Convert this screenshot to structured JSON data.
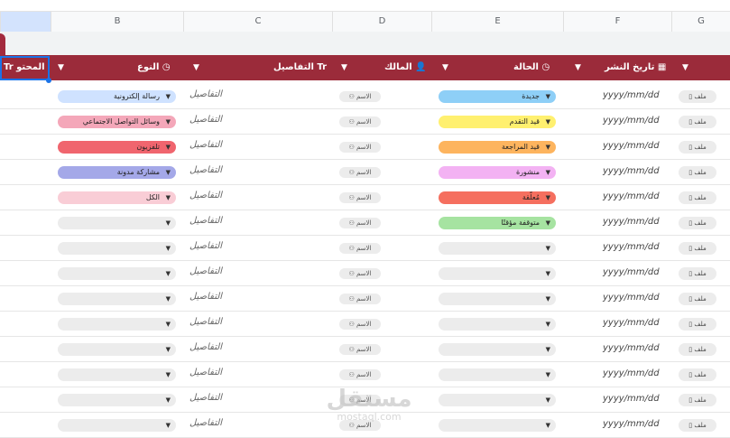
{
  "columns": [
    "B",
    "C",
    "D",
    "E",
    "F",
    "G"
  ],
  "headers": {
    "content": "المحتو",
    "type": "النوع",
    "details": "التفاصيل",
    "owner": "المالك",
    "status": "الحالة",
    "publish_date": "تاريخ النشر"
  },
  "header_icon_text": "Tr",
  "colors": {
    "header_bg": "#9b2b3a",
    "type_chips": [
      "#cfe2ff",
      "#f4a7b9",
      "#f0656e",
      "#a4a8e8",
      "#f9cdd6"
    ],
    "status_chips": [
      "#8ecff7",
      "#fff06f",
      "#fdb45e",
      "#f3b2f3",
      "#f56f5f",
      "#a6e3a1"
    ]
  },
  "rows": [
    {
      "type": "رسالة إلكترونية",
      "details": "التفاصيل",
      "owner": "الاسم",
      "status": "جديدة",
      "date": "yyyy/mm/dd",
      "file": "ملف"
    },
    {
      "type": "وسائل التواصل الاجتماعي",
      "details": "التفاصيل",
      "owner": "الاسم",
      "status": "قيد التقدم",
      "date": "yyyy/mm/dd",
      "file": "ملف"
    },
    {
      "type": "تلفزيون",
      "details": "التفاصيل",
      "owner": "الاسم",
      "status": "قيد المراجعة",
      "date": "yyyy/mm/dd",
      "file": "ملف"
    },
    {
      "type": "مشاركة مدونة",
      "details": "التفاصيل",
      "owner": "الاسم",
      "status": "منشورة",
      "date": "yyyy/mm/dd",
      "file": "ملف"
    },
    {
      "type": "الكل",
      "details": "التفاصيل",
      "owner": "الاسم",
      "status": "مُعلّقة",
      "date": "yyyy/mm/dd",
      "file": "ملف"
    },
    {
      "type": "",
      "details": "التفاصيل",
      "owner": "الاسم",
      "status": "متوقفة مؤقتًا",
      "date": "yyyy/mm/dd",
      "file": "ملف"
    },
    {
      "type": "",
      "details": "التفاصيل",
      "owner": "الاسم",
      "status": "",
      "date": "yyyy/mm/dd",
      "file": "ملف"
    },
    {
      "type": "",
      "details": "التفاصيل",
      "owner": "الاسم",
      "status": "",
      "date": "yyyy/mm/dd",
      "file": "ملف"
    },
    {
      "type": "",
      "details": "التفاصيل",
      "owner": "الاسم",
      "status": "",
      "date": "yyyy/mm/dd",
      "file": "ملف"
    },
    {
      "type": "",
      "details": "التفاصيل",
      "owner": "الاسم",
      "status": "",
      "date": "yyyy/mm/dd",
      "file": "ملف"
    },
    {
      "type": "",
      "details": "التفاصيل",
      "owner": "الاسم",
      "status": "",
      "date": "yyyy/mm/dd",
      "file": "ملف"
    },
    {
      "type": "",
      "details": "التفاصيل",
      "owner": "الاسم",
      "status": "",
      "date": "yyyy/mm/dd",
      "file": "ملف"
    },
    {
      "type": "",
      "details": "التفاصيل",
      "owner": "الاسم",
      "status": "",
      "date": "yyyy/mm/dd",
      "file": "ملف"
    },
    {
      "type": "",
      "details": "التفاصيل",
      "owner": "الاسم",
      "status": "",
      "date": "yyyy/mm/dd",
      "file": "ملف"
    }
  ],
  "watermark": {
    "arabic": "مستقل",
    "latin": "mostaql.com"
  }
}
